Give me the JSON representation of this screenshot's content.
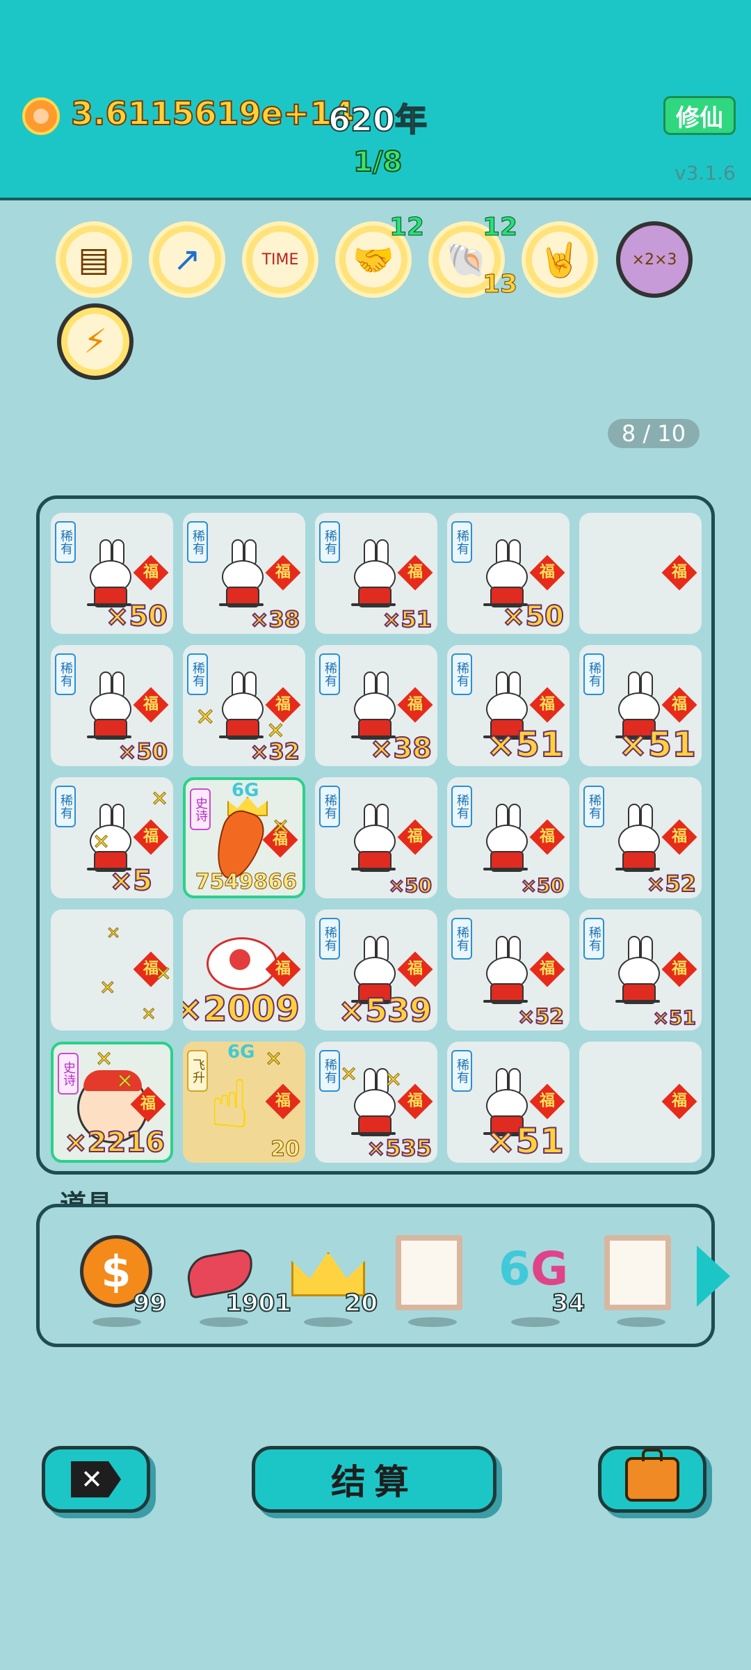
{
  "header": {
    "money": "3.6115619e+14",
    "year": "620年",
    "cultivate_button": "修仙",
    "round": "1/8",
    "version": "v3.1.6"
  },
  "relics": [
    {
      "name": "skirt-icon"
    },
    {
      "name": "arrow-up-icon"
    },
    {
      "name": "time-magazine-icon"
    },
    {
      "name": "handshake-icon",
      "badge": "12"
    },
    {
      "name": "shell-icon",
      "badge": "12",
      "badge2": "13"
    },
    {
      "name": "rock-hand-icon"
    },
    {
      "name": "multiplier-avatar-icon"
    },
    {
      "name": "lightning-icon"
    }
  ],
  "board": {
    "slots_counter": "8 / 10",
    "rarity_rare": "稀有",
    "rarity_epic": "史诗",
    "rarity_rise": "飞升",
    "fu": "福",
    "tag_6g": "6G",
    "cells": [
      {
        "count": "×50"
      },
      {
        "count": "×38"
      },
      {
        "count": "×51"
      },
      {
        "count": "×50"
      },
      {
        "count": ""
      },
      {
        "count": "×50"
      },
      {
        "count": "×32"
      },
      {
        "count": "×38"
      },
      {
        "count": "×51"
      },
      {
        "count": "×51"
      },
      {
        "count": "×5"
      },
      {
        "count": "7549866"
      },
      {
        "count": "×50"
      },
      {
        "count": "×50"
      },
      {
        "count": "×52"
      },
      {
        "count": ""
      },
      {
        "count": "×2009"
      },
      {
        "count": "×539"
      },
      {
        "count": "×52"
      },
      {
        "count": "×51"
      },
      {
        "count": "×2216"
      },
      {
        "count": "20"
      },
      {
        "count": "×535"
      },
      {
        "count": "×51"
      },
      {
        "count": ""
      }
    ]
  },
  "items": {
    "label": "道具",
    "list": [
      {
        "name": "coin-item-icon",
        "qty": "99"
      },
      {
        "name": "liver-item-icon",
        "qty": "1901"
      },
      {
        "name": "crown-item-icon",
        "qty": "20"
      },
      {
        "name": "frame-item-icon",
        "qty": ""
      },
      {
        "name": "6g-item-icon",
        "qty": "34"
      },
      {
        "name": "frame-item-icon",
        "qty": ""
      }
    ]
  },
  "buttons": {
    "close": "✕",
    "settle": "结算"
  },
  "colors": {
    "header_bg": "#1cc6c7",
    "page_bg": "#a7d8dc",
    "money": "#ffd23a",
    "round": "#3de36f"
  }
}
